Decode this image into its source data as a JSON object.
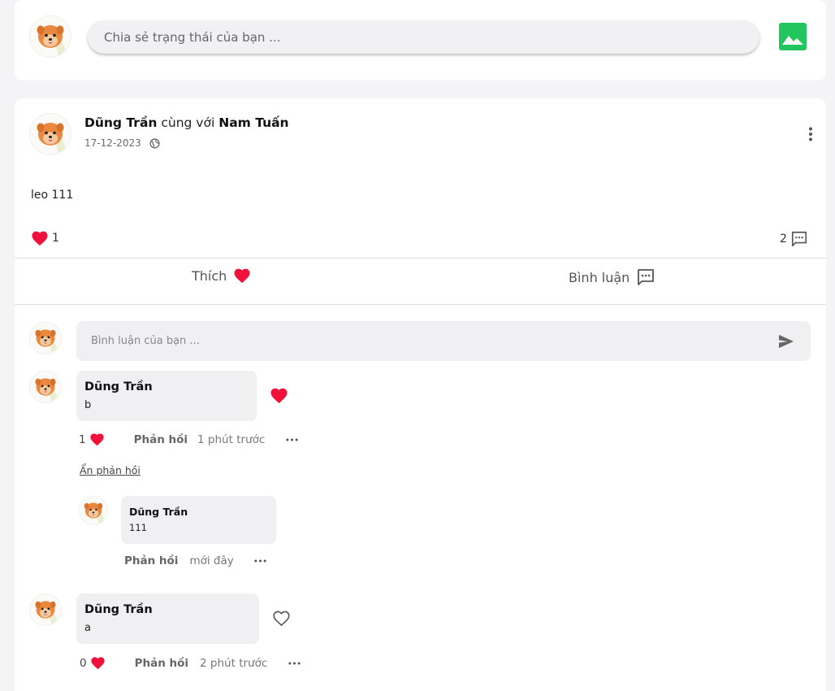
{
  "composer": {
    "placeholder": "Chia sẻ trạng thái của bạn ...",
    "image_icon": "image-icon",
    "accent": "#22c55e"
  },
  "post": {
    "author": "Dũng Trần",
    "with_text": "cùng với",
    "tagged": "Nam Tuấn",
    "date": "17-12-2023",
    "privacy_icon": "globe-icon",
    "text": "leo 111",
    "like_count": "1",
    "comment_count": "2",
    "actions": {
      "like_label": "Thích",
      "comment_label": "Bình luận"
    },
    "heart_color": "#f0123b"
  },
  "comment_box": {
    "placeholder": "Bình luận của bạn ..."
  },
  "comments": [
    {
      "author": "Dũng Trần",
      "text": "b",
      "likes": "1",
      "liked": true,
      "reply_label": "Phản hồi",
      "time": "1 phút trước",
      "hide_replies_label": "Ẩn phản hồi",
      "replies": [
        {
          "author": "Dũng Trần",
          "text": "111",
          "reply_label": "Phản hồi",
          "time": "mới đây"
        }
      ]
    },
    {
      "author": "Dũng Trần",
      "text": "a",
      "likes": "0",
      "liked": false,
      "reply_label": "Phản hồi",
      "time": "2 phút trước"
    }
  ]
}
